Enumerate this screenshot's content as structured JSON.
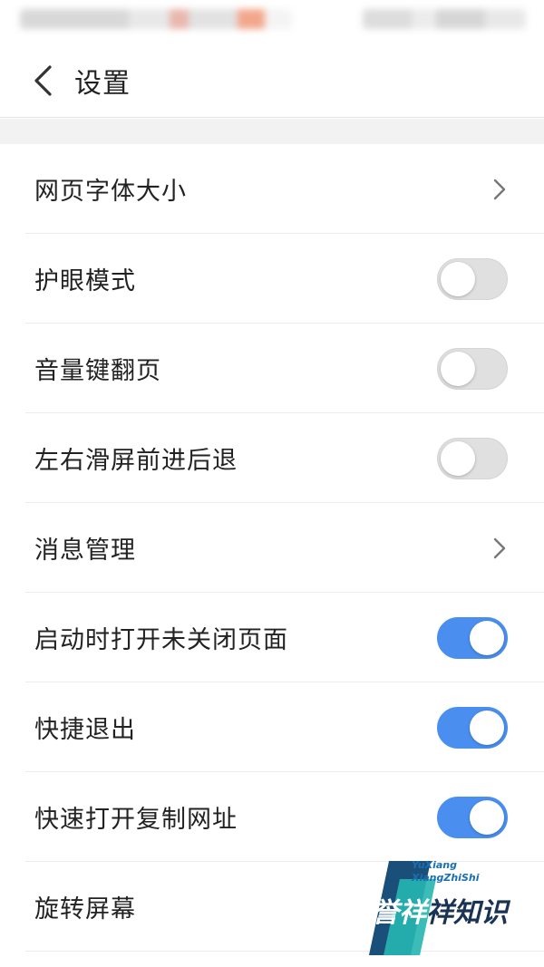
{
  "header": {
    "title": "设置",
    "back_icon": "chevron-left-icon"
  },
  "settings": [
    {
      "id": "font-size",
      "label": "网页字体大小",
      "control": "chevron"
    },
    {
      "id": "eye-protection",
      "label": "护眼模式",
      "control": "toggle",
      "on": false
    },
    {
      "id": "volume-key-page",
      "label": "音量键翻页",
      "control": "toggle",
      "on": false
    },
    {
      "id": "swipe-navigation",
      "label": "左右滑屏前进后退",
      "control": "toggle",
      "on": false
    },
    {
      "id": "message-management",
      "label": "消息管理",
      "control": "chevron"
    },
    {
      "id": "restore-pages",
      "label": "启动时打开未关闭页面",
      "control": "toggle",
      "on": true
    },
    {
      "id": "quick-exit",
      "label": "快捷退出",
      "control": "toggle",
      "on": true
    },
    {
      "id": "open-copied-url",
      "label": "快速打开复制网址",
      "control": "toggle",
      "on": true
    },
    {
      "id": "rotate-screen",
      "label": "旋转屏幕",
      "control": "none"
    }
  ],
  "watermark": {
    "line1": "YuXiang",
    "line2": "XiangZhiShi",
    "brand_a": "誉祥",
    "brand_b": "祥知识"
  },
  "colors": {
    "toggle_on": "#4a8ff0",
    "toggle_off": "#e0e0e0",
    "divider": "#ececec"
  }
}
